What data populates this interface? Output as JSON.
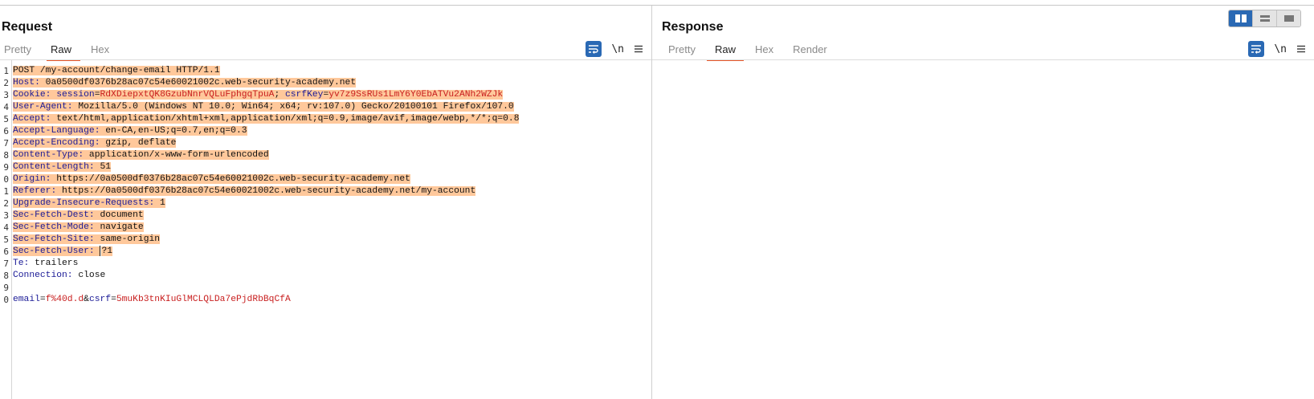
{
  "request": {
    "title": "Request",
    "tabs": [
      {
        "label": "Pretty",
        "active": false
      },
      {
        "label": "Raw",
        "active": true
      },
      {
        "label": "Hex",
        "active": false
      }
    ],
    "tools": {
      "wrap_icon": "word-wrap-icon",
      "newline_label": "\\n",
      "menu_icon": "hamburger-menu-icon"
    },
    "line_numbers": [
      "1",
      "2",
      "3",
      "4",
      "5",
      "6",
      "7",
      "8",
      "9",
      "0",
      "1",
      "2",
      "3",
      "4",
      "5",
      "6",
      "7",
      "8",
      "9",
      "0"
    ],
    "lines": {
      "request_line": "POST /my-account/change-email HTTP/1.1",
      "host_key": "Host:",
      "host_val": " 0a0500df0376b28ac07c54e60021002c.web-security-academy.net",
      "cookie_key": "Cookie:",
      "cookie_space": " ",
      "cookie_name1": "session",
      "cookie_eq1": "=",
      "cookie_val1": "RdXDiepxtQK8GzubNnrVQLuFphgqTpuA",
      "cookie_sep": "; ",
      "cookie_name2": "csrfKey",
      "cookie_eq2": "=",
      "cookie_val2": "yv7z9SsRUs1LmY6Y0EbATVu2ANh2WZJk",
      "ua_key": "User-Agent:",
      "ua_val": " Mozilla/5.0 (Windows NT 10.0; Win64; x64; rv:107.0) Gecko/20100101 Firefox/107.0",
      "accept_key": "Accept:",
      "accept_val": " text/html,application/xhtml+xml,application/xml;q=0.9,image/avif,image/webp,*/*;q=0.8",
      "alang_key": "Accept-Language:",
      "alang_val": " en-CA,en-US;q=0.7,en;q=0.3",
      "aenc_key": "Accept-Encoding:",
      "aenc_val": " gzip, deflate",
      "ctype_key": "Content-Type:",
      "ctype_val": " application/x-www-form-urlencoded",
      "clen_key": "Content-Length:",
      "clen_val": " 51",
      "origin_key": "Origin:",
      "origin_val": " https://0a0500df0376b28ac07c54e60021002c.web-security-academy.net",
      "referer_key": "Referer:",
      "referer_val": " https://0a0500df0376b28ac07c54e60021002c.web-security-academy.net/my-account",
      "uir_key": "Upgrade-Insecure-Requests:",
      "uir_val": " 1",
      "sfd_key": "Sec-Fetch-Dest:",
      "sfd_val": " document",
      "sfm_key": "Sec-Fetch-Mode:",
      "sfm_val": " navigate",
      "sfs_key": "Sec-Fetch-Site:",
      "sfs_val": " same-origin",
      "sfu_key": "Sec-Fetch-User:",
      "sfu_space": " ",
      "sfu_val": "?1",
      "te_key": "Te:",
      "te_val": " trailers",
      "conn_key": "Connection:",
      "conn_val": " close",
      "body_k1": "email",
      "body_eq1": "=",
      "body_v1": "f%40d.d",
      "body_amp": "&",
      "body_k2": "csrf",
      "body_eq2": "=",
      "body_v2": "5muKb3tnKIuGlMCLQLDa7ePjdRbBqCfA"
    }
  },
  "response": {
    "title": "Response",
    "tabs": [
      {
        "label": "Pretty",
        "active": false
      },
      {
        "label": "Raw",
        "active": true
      },
      {
        "label": "Hex",
        "active": false
      },
      {
        "label": "Render",
        "active": false
      }
    ],
    "tools": {
      "wrap_icon": "word-wrap-icon",
      "newline_label": "\\n",
      "menu_icon": "hamburger-menu-icon"
    }
  },
  "layout_toggle": {
    "options": [
      "side-by-side-icon",
      "stacked-icon",
      "single-pane-icon"
    ],
    "selected": "side-by-side-icon"
  },
  "colors": {
    "accent_blue": "#2a69b4",
    "active_tab_underline": "#e8572a",
    "highlight": "#ffc89b",
    "header_key": "#1a1a96",
    "param_value": "#c81e1e"
  }
}
